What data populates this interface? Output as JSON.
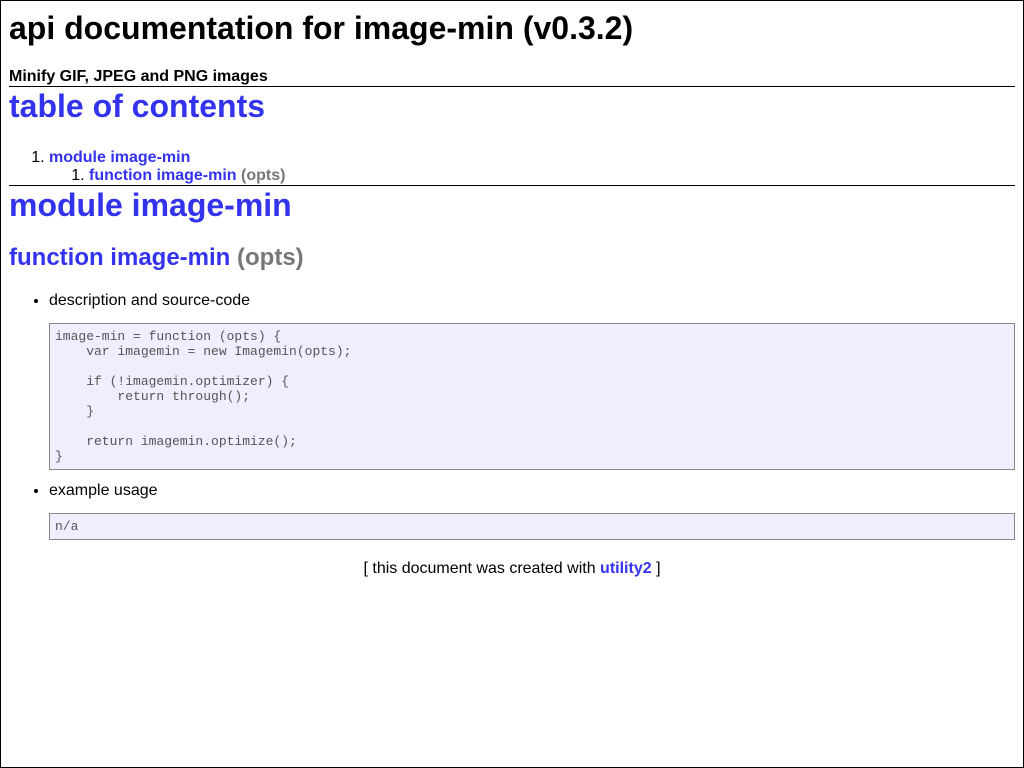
{
  "header": {
    "title": "api documentation for image-min (v0.3.2)",
    "subtitle": "Minify GIF, JPEG and PNG images"
  },
  "toc": {
    "heading": "table of contents",
    "items": [
      {
        "label": "module image-min",
        "children": [
          {
            "label": "function image-min",
            "signature": "(opts)"
          }
        ]
      }
    ]
  },
  "module": {
    "heading": "module image-min",
    "functions": [
      {
        "name": "function image-min",
        "signature": "(opts)",
        "description_label": "description and source-code",
        "source_code": "image-min = function (opts) {\n    var imagemin = new Imagemin(opts);\n\n    if (!imagemin.optimizer) {\n        return through();\n    }\n\n    return imagemin.optimize();\n}",
        "example_label": "example usage",
        "example_code": "n/a"
      }
    ]
  },
  "footer": {
    "prefix": "[ this document was created with",
    "link_label": "utility2",
    "suffix": "]"
  },
  "colors": {
    "link": "#3333ee",
    "signature": "#777777",
    "code_background": "#eeeeff",
    "code_text": "#555555"
  }
}
